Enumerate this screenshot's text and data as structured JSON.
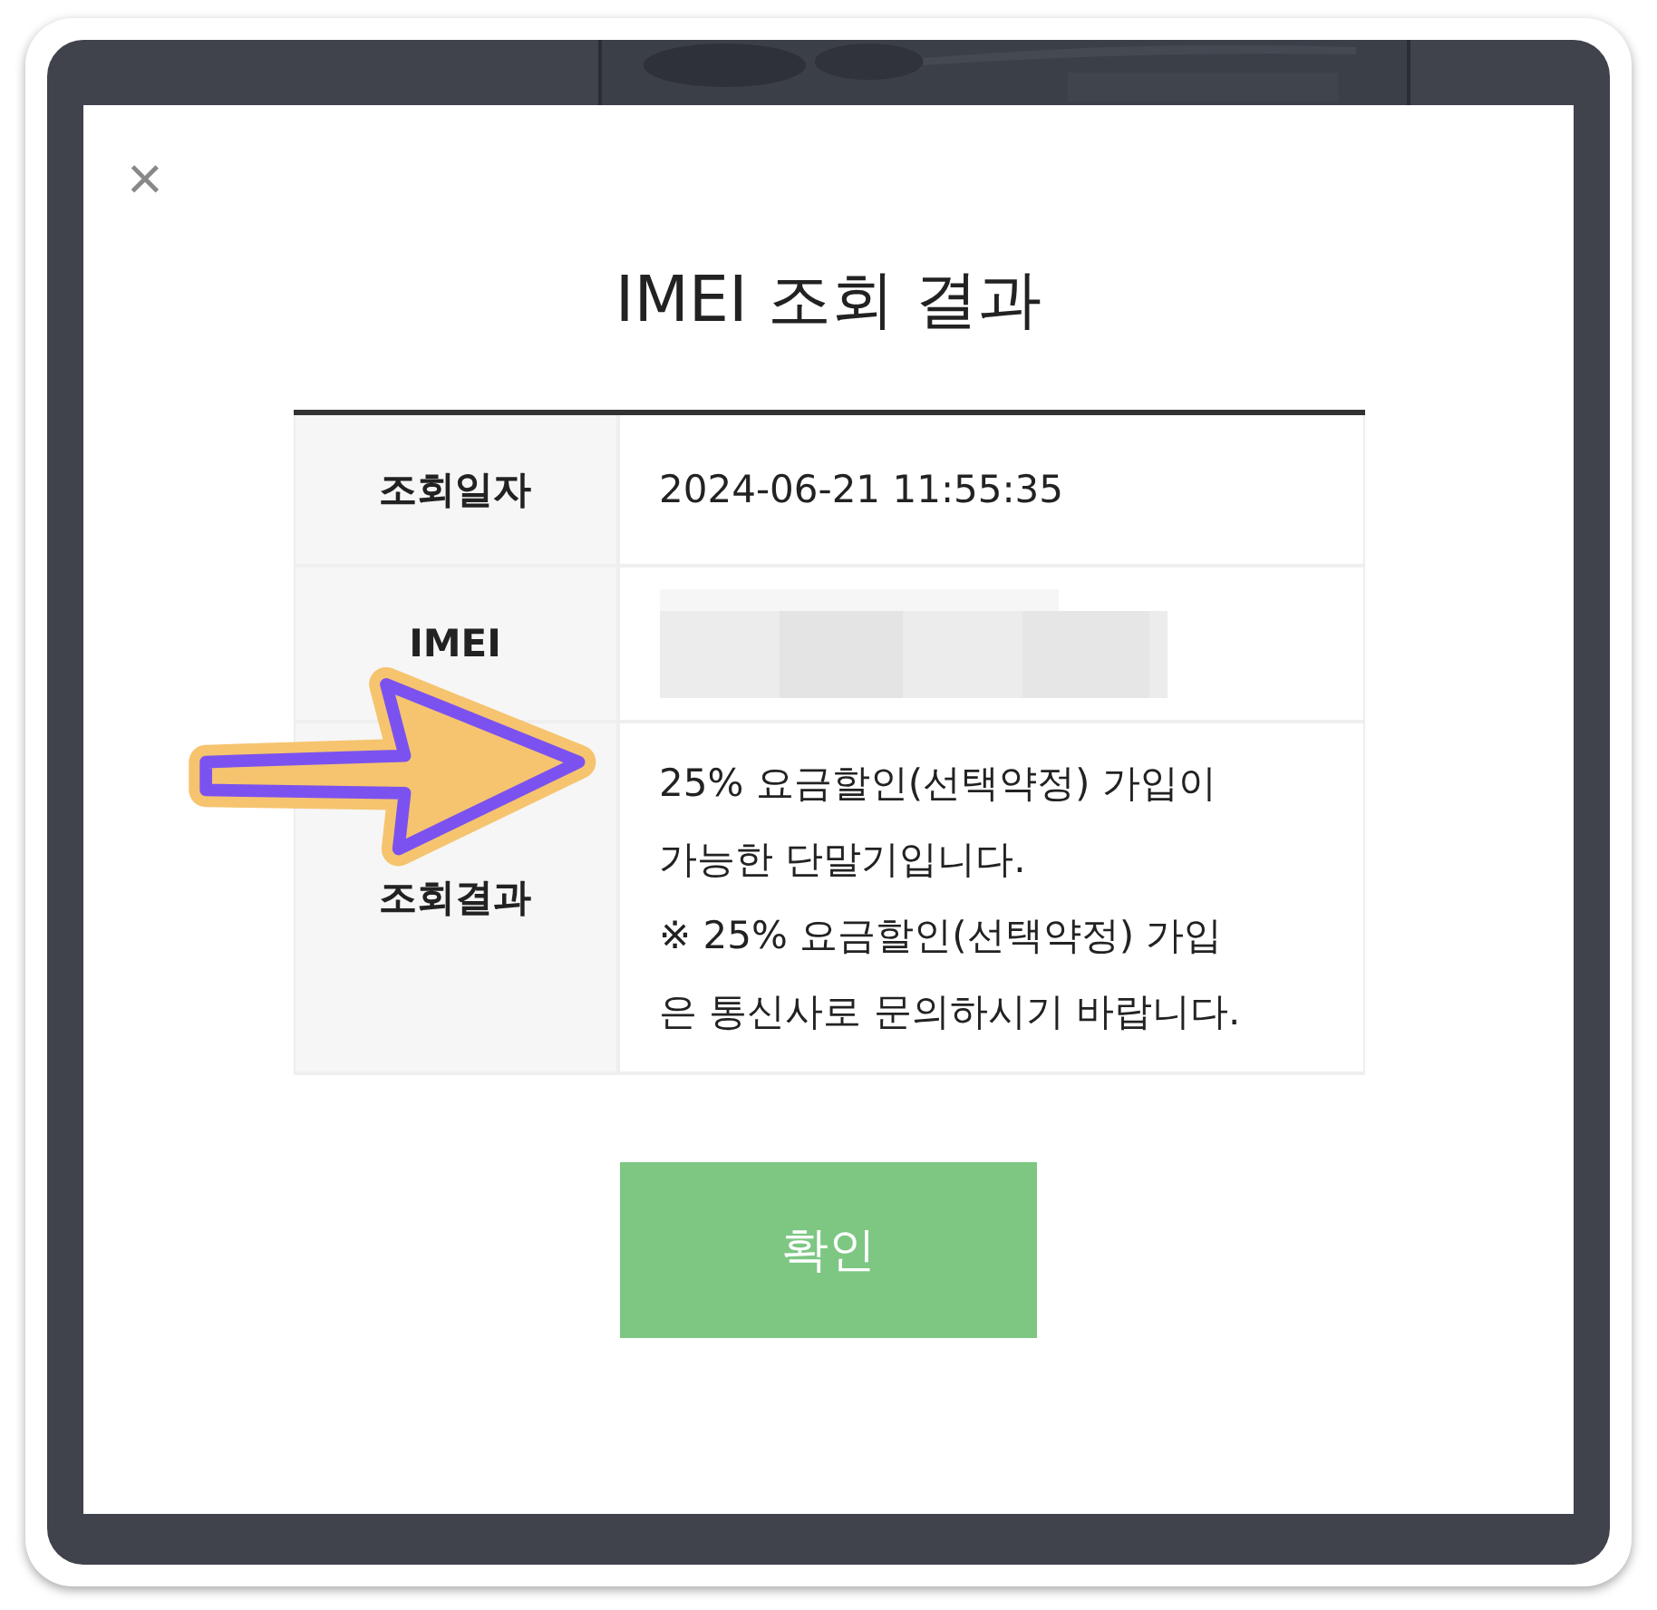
{
  "dialog": {
    "close": "×",
    "title": "IMEI 조회 결과",
    "rows": [
      {
        "label": "조회일자",
        "kind": "text",
        "paragraphs": [
          "2024-06-21 11:55:35"
        ]
      },
      {
        "label": "IMEI",
        "kind": "redacted"
      },
      {
        "label": "조회결과",
        "kind": "text",
        "paragraphs": [
          "25% 요금할인(선택약정) 가입이 가능한 단말기입니다.",
          "※ 25% 요금할인(선택약정) 가입은 통신사로 문의하시기 바랍니다."
        ]
      }
    ],
    "confirm_button": "확인"
  }
}
